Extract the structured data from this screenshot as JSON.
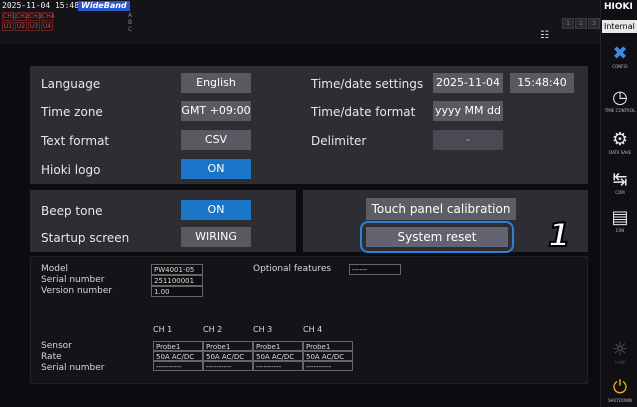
{
  "status": {
    "timestamp": "2025-11-04 15:48:40",
    "mode_badge": "WideBand",
    "channels": [
      "CH1",
      "CH2",
      "CH3",
      "CH4",
      "U1",
      "U2",
      "U3",
      "U4"
    ],
    "mini": [
      "A",
      "B",
      "C"
    ],
    "pages": [
      "1",
      "2",
      "3",
      "4"
    ]
  },
  "sidebar": {
    "brand": "HIOKI",
    "tab": "Internal",
    "items": [
      {
        "icon": "tools-icon",
        "label": "CONFIG"
      },
      {
        "icon": "clock-icon",
        "label": "TIME CONTROL"
      },
      {
        "icon": "data-save-icon",
        "label": "DATA SAVE"
      },
      {
        "icon": "com-icon",
        "label": "COM"
      },
      {
        "icon": "can-icon",
        "label": "CAN"
      },
      {
        "icon": "lamp-icon",
        "label": "LAMP"
      },
      {
        "icon": "shutdown-icon",
        "label": "SHUTDOWN"
      }
    ]
  },
  "settings": {
    "language_label": "Language",
    "language_value": "English",
    "timezone_label": "Time zone",
    "timezone_value": "GMT +09:00",
    "textformat_label": "Text format",
    "textformat_value": "CSV",
    "logo_label": "Hioki logo",
    "logo_value": "ON",
    "timedate_label": "Time/date settings",
    "date_value": "2025-11-04",
    "time_value": "15:48:40",
    "timeformat_label": "Time/date format",
    "timeformat_value": "yyyy MM dd",
    "delimiter_label": "Delimiter",
    "delimiter_value": "-",
    "beep_label": "Beep tone",
    "beep_value": "ON",
    "startup_label": "Startup screen",
    "startup_value": "WIRING",
    "touch_cal": "Touch panel calibration",
    "system_reset": "System reset"
  },
  "callout": "1",
  "info": {
    "model_label": "Model",
    "model_value": "PW4001-05",
    "serial_label": "Serial number",
    "serial_value": "251100001",
    "version_label": "Version number",
    "version_value": "1.00",
    "options_label": "Optional features",
    "options_value": "------",
    "channels": [
      "CH 1",
      "CH 2",
      "CH 3",
      "CH 4"
    ],
    "sensor_label": "Sensor",
    "rate_label": "Rate",
    "sensor_serial_label": "Serial number",
    "sensors": [
      "Probe1",
      "Probe1",
      "Probe1",
      "Probe1"
    ],
    "rates": [
      "50A AC/DC",
      "50A AC/DC",
      "50A AC/DC",
      "50A AC/DC"
    ],
    "serials": [
      "----------",
      "----------",
      "----------",
      "----------"
    ]
  }
}
